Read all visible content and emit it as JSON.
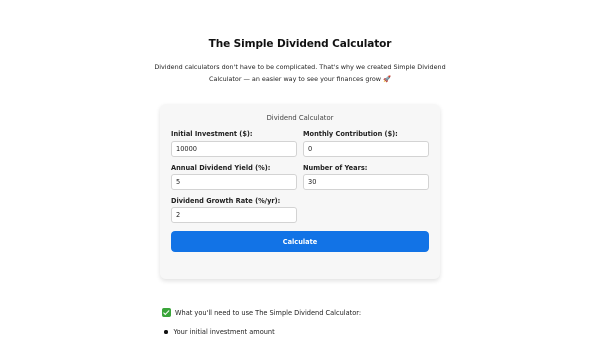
{
  "page": {
    "title": "The Simple Dividend Calculator",
    "intro": "Dividend calculators don't have to be complicated. That's why we created Simple Dividend Calculator — an easier way to see your finances grow 🚀"
  },
  "calculator": {
    "title": "Dividend Calculator",
    "fields": {
      "initial_investment": {
        "label": "Initial Investment ($):",
        "value": "10000"
      },
      "monthly_contribution": {
        "label": "Monthly Contribution ($):",
        "value": "0"
      },
      "annual_yield": {
        "label": "Annual Dividend Yield (%):",
        "value": "5"
      },
      "years": {
        "label": "Number of Years:",
        "value": "30"
      },
      "growth_rate": {
        "label": "Dividend Growth Rate (%/yr):",
        "value": "2"
      }
    },
    "button_label": "Calculate"
  },
  "requirements": {
    "heading": "What you'll need to use The Simple Dividend Calculator:",
    "icon": "check-mark-icon",
    "items": [
      "Your initial investment amount"
    ]
  },
  "colors": {
    "accent": "#1273e6",
    "check": "#3aa53a",
    "card_bg": "#f7f7f7"
  }
}
